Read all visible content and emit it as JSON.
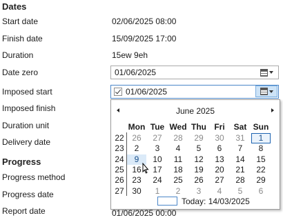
{
  "dates_section": {
    "title": "Dates",
    "start_date": {
      "label": "Start date",
      "value": "02/06/2025 08:00"
    },
    "finish_date": {
      "label": "Finish date",
      "value": "15/09/2025 17:00"
    },
    "duration": {
      "label": "Duration",
      "value": "15ew 9eh"
    },
    "date_zero": {
      "label": "Date zero",
      "value": "01/06/2025"
    },
    "imposed_start": {
      "label": "Imposed start",
      "value": "01/06/2025",
      "checked": true
    },
    "imposed_finish": {
      "label": "Imposed finish"
    },
    "duration_unit": {
      "label": "Duration unit"
    },
    "delivery_date": {
      "label": "Delivery date"
    }
  },
  "progress_section": {
    "title": "Progress",
    "progress_method": {
      "label": "Progress method"
    },
    "progress_date": {
      "label": "Progress date"
    },
    "report_date": {
      "label": "Report date",
      "value": "01/06/2025 00:00"
    }
  },
  "calendar": {
    "month_title": "June 2025",
    "weekdays": [
      "Mon",
      "Tue",
      "Wed",
      "Thu",
      "Fri",
      "Sat",
      "Sun"
    ],
    "weeks": [
      {
        "no": "22",
        "days": [
          {
            "d": "26",
            "o": true
          },
          {
            "d": "27",
            "o": true
          },
          {
            "d": "28",
            "o": true
          },
          {
            "d": "29",
            "o": true
          },
          {
            "d": "30",
            "o": true
          },
          {
            "d": "31",
            "o": true
          },
          {
            "d": "1",
            "sel": true
          }
        ]
      },
      {
        "no": "23",
        "days": [
          {
            "d": "2"
          },
          {
            "d": "3"
          },
          {
            "d": "4"
          },
          {
            "d": "5"
          },
          {
            "d": "6"
          },
          {
            "d": "7"
          },
          {
            "d": "8"
          }
        ]
      },
      {
        "no": "24",
        "days": [
          {
            "d": "9",
            "hover": true
          },
          {
            "d": "10"
          },
          {
            "d": "11"
          },
          {
            "d": "12"
          },
          {
            "d": "13"
          },
          {
            "d": "14"
          },
          {
            "d": "15"
          }
        ]
      },
      {
        "no": "25",
        "days": [
          {
            "d": "16"
          },
          {
            "d": "17"
          },
          {
            "d": "18"
          },
          {
            "d": "19"
          },
          {
            "d": "20"
          },
          {
            "d": "21"
          },
          {
            "d": "22"
          }
        ]
      },
      {
        "no": "26",
        "days": [
          {
            "d": "23"
          },
          {
            "d": "24"
          },
          {
            "d": "25"
          },
          {
            "d": "26"
          },
          {
            "d": "27"
          },
          {
            "d": "28"
          },
          {
            "d": "29"
          }
        ]
      },
      {
        "no": "27",
        "days": [
          {
            "d": "30"
          },
          {
            "d": "1",
            "o": true
          },
          {
            "d": "2",
            "o": true
          },
          {
            "d": "3",
            "o": true
          },
          {
            "d": "4",
            "o": true
          },
          {
            "d": "5",
            "o": true
          },
          {
            "d": "6",
            "o": true
          }
        ]
      }
    ],
    "today_label": "Today: 14/03/2025"
  },
  "colors": {
    "accent": "#1c63b0",
    "hover_bg": "#dbeaf8",
    "muted": "#8a8a8a"
  }
}
